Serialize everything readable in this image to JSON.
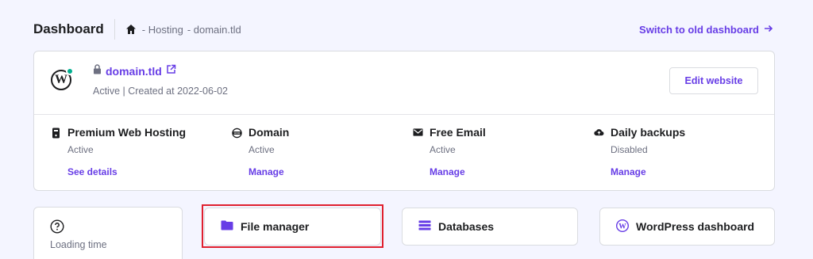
{
  "header": {
    "title": "Dashboard",
    "breadcrumb": [
      "- Hosting",
      "- domain.tld"
    ],
    "switch_link": "Switch to old dashboard"
  },
  "site": {
    "name": "domain.tld",
    "meta": "Active | Created at 2022-06-02",
    "edit_button": "Edit website"
  },
  "services": [
    {
      "title": "Premium Web Hosting",
      "status": "Active",
      "link": "See details",
      "icon": "server-icon"
    },
    {
      "title": "Domain",
      "status": "Active",
      "link": "Manage",
      "icon": "www-icon"
    },
    {
      "title": "Free Email",
      "status": "Active",
      "link": "Manage",
      "icon": "mail-icon"
    },
    {
      "title": "Daily backups",
      "status": "Disabled",
      "link": "Manage",
      "icon": "cloud-upload-icon"
    }
  ],
  "loading": {
    "label": "Loading time"
  },
  "tiles": [
    {
      "label": "File manager",
      "icon": "folder-icon"
    },
    {
      "label": "Databases",
      "icon": "database-icon"
    },
    {
      "label": "WordPress dashboard",
      "icon": "wordpress-icon"
    }
  ],
  "colors": {
    "accent": "#673de6",
    "background": "#f4f5ff",
    "highlight": "#e0202e",
    "online": "#00b090"
  }
}
